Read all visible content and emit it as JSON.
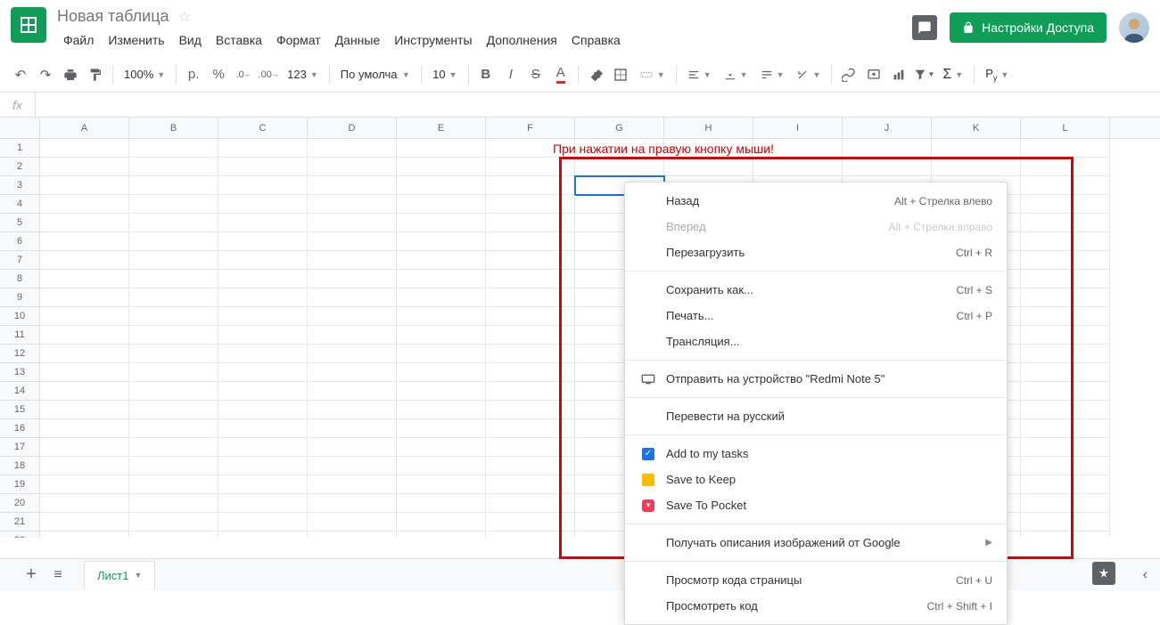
{
  "doc": {
    "title": "Новая таблица"
  },
  "menubar": [
    "Файл",
    "Изменить",
    "Вид",
    "Вставка",
    "Формат",
    "Данные",
    "Инструменты",
    "Дополнения",
    "Справка"
  ],
  "share": {
    "label": "Настройки Доступа"
  },
  "toolbar": {
    "zoom": "100%",
    "currency": "р.",
    "percent": "%",
    "dec_less": ".0",
    "dec_more": ".00",
    "format": "123",
    "font": "По умолча...",
    "size": "10"
  },
  "fx_label": "fx",
  "columns": [
    "A",
    "B",
    "C",
    "D",
    "E",
    "F",
    "G",
    "H",
    "I",
    "J",
    "K",
    "L"
  ],
  "row_count": 22,
  "selected_cell": {
    "row": 3,
    "col": 6
  },
  "annotation": "При нажатии на правую кнопку мыши!",
  "context_menu": [
    {
      "type": "item",
      "label": "Назад",
      "shortcut": "Alt + Стрелка влево",
      "icon": ""
    },
    {
      "type": "item",
      "label": "Вперед",
      "shortcut": "Alt + Стрелка вправо",
      "icon": "",
      "disabled": true
    },
    {
      "type": "item",
      "label": "Перезагрузить",
      "shortcut": "Ctrl + R",
      "icon": ""
    },
    {
      "type": "sep"
    },
    {
      "type": "item",
      "label": "Сохранить как...",
      "shortcut": "Ctrl + S",
      "icon": ""
    },
    {
      "type": "item",
      "label": "Печать...",
      "shortcut": "Ctrl + P",
      "icon": ""
    },
    {
      "type": "item",
      "label": "Трансляция...",
      "shortcut": "",
      "icon": ""
    },
    {
      "type": "sep"
    },
    {
      "type": "item",
      "label": "Отправить на устройство \"Redmi Note 5\"",
      "shortcut": "",
      "icon": "device"
    },
    {
      "type": "sep"
    },
    {
      "type": "item",
      "label": "Перевести на русский",
      "shortcut": "",
      "icon": ""
    },
    {
      "type": "sep"
    },
    {
      "type": "item",
      "label": "Add to my tasks",
      "shortcut": "",
      "icon": "check-blue"
    },
    {
      "type": "item",
      "label": "Save to Keep",
      "shortcut": "",
      "icon": "keep"
    },
    {
      "type": "item",
      "label": "Save To Pocket",
      "shortcut": "",
      "icon": "pocket"
    },
    {
      "type": "sep"
    },
    {
      "type": "item",
      "label": "Получать описания изображений от Google",
      "shortcut": "",
      "icon": "",
      "submenu": true
    },
    {
      "type": "sep"
    },
    {
      "type": "item",
      "label": "Просмотр кода страницы",
      "shortcut": "Ctrl + U",
      "icon": ""
    },
    {
      "type": "item",
      "label": "Просмотреть код",
      "shortcut": "Ctrl + Shift + I",
      "icon": ""
    }
  ],
  "sheet": {
    "active": "Лист1"
  }
}
